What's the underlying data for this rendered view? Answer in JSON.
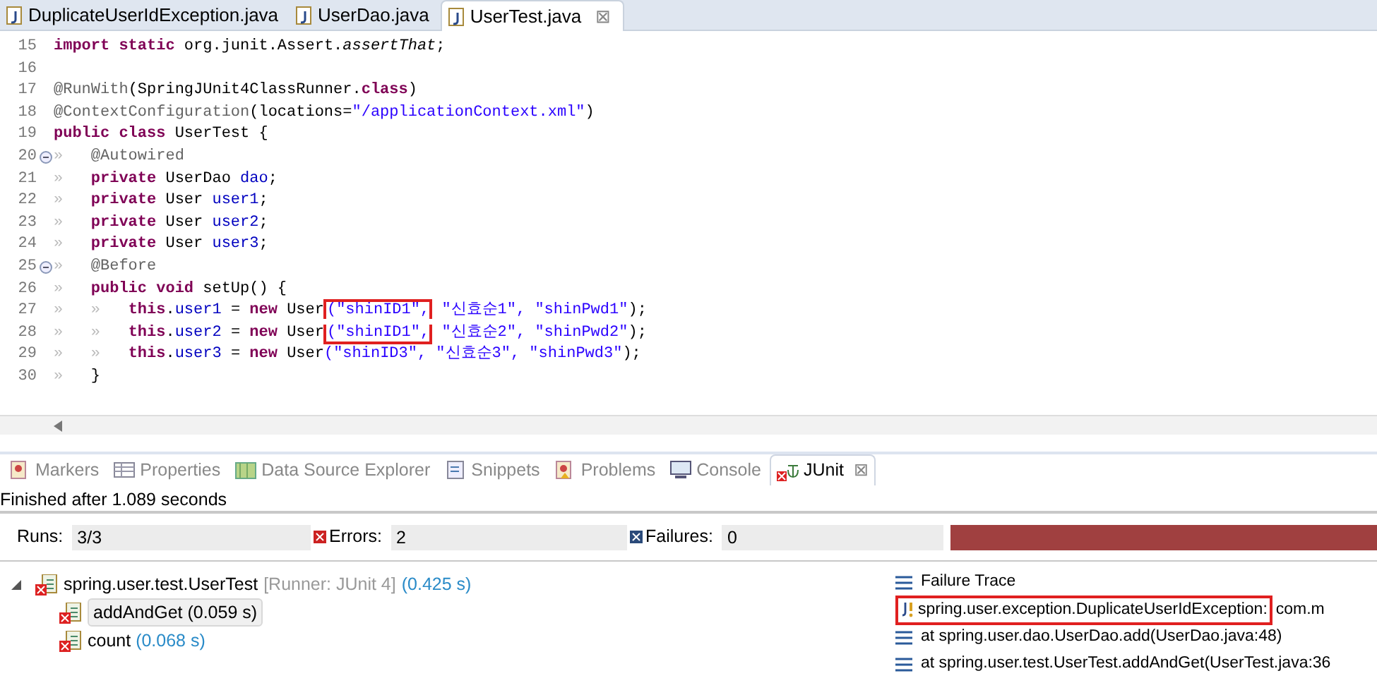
{
  "editor_tabs": [
    {
      "label": "DuplicateUserIdException.java",
      "selected": false
    },
    {
      "label": "UserDao.java",
      "selected": false
    },
    {
      "label": "UserTest.java",
      "selected": true,
      "close": "⊠"
    }
  ],
  "code_lines": [
    {
      "number": "15",
      "segments": [
        {
          "kind": "kw",
          "text": "import static "
        },
        {
          "kind": "plain",
          "text": "org.junit.Assert."
        },
        {
          "kind": "italic",
          "text": "assertThat"
        },
        {
          "kind": "plain",
          "text": ";"
        }
      ]
    },
    {
      "number": "16"
    },
    {
      "number": "17",
      "segments": [
        {
          "kind": "ann",
          "text": "@RunWith"
        },
        {
          "kind": "plain",
          "text": "(SpringJUnit4ClassRunner."
        },
        {
          "kind": "kw",
          "text": "class"
        },
        {
          "kind": "plain",
          "text": ")"
        }
      ]
    },
    {
      "number": "18",
      "segments": [
        {
          "kind": "ann",
          "text": "@ContextConfiguration"
        },
        {
          "kind": "plain",
          "text": "(locations="
        },
        {
          "kind": "str",
          "text": "\"/applicationContext.xml\""
        },
        {
          "kind": "plain",
          "text": ")"
        }
      ]
    },
    {
      "number": "19",
      "segments": [
        {
          "kind": "kw",
          "text": "public class "
        },
        {
          "kind": "plain",
          "text": "UserTest {"
        }
      ]
    },
    {
      "number": "20",
      "fold": true,
      "segments": [
        {
          "kind": "tab",
          "text": "»   "
        },
        {
          "kind": "ann",
          "text": "@Autowired"
        }
      ]
    },
    {
      "number": "21",
      "segments": [
        {
          "kind": "tab",
          "text": "»   "
        },
        {
          "kind": "kw",
          "text": "private "
        },
        {
          "kind": "plain",
          "text": "UserDao "
        },
        {
          "kind": "field",
          "text": "dao"
        },
        {
          "kind": "plain",
          "text": ";"
        }
      ]
    },
    {
      "number": "22",
      "segments": [
        {
          "kind": "tab",
          "text": "»   "
        },
        {
          "kind": "kw",
          "text": "private "
        },
        {
          "kind": "plain",
          "text": "User "
        },
        {
          "kind": "field",
          "text": "user1"
        },
        {
          "kind": "plain",
          "text": ";"
        }
      ]
    },
    {
      "number": "23",
      "segments": [
        {
          "kind": "tab",
          "text": "»   "
        },
        {
          "kind": "kw",
          "text": "private "
        },
        {
          "kind": "plain",
          "text": "User "
        },
        {
          "kind": "field",
          "text": "user2"
        },
        {
          "kind": "plain",
          "text": ";"
        }
      ]
    },
    {
      "number": "24",
      "segments": [
        {
          "kind": "tab",
          "text": "»   "
        },
        {
          "kind": "kw",
          "text": "private "
        },
        {
          "kind": "plain",
          "text": "User "
        },
        {
          "kind": "field",
          "text": "user3"
        },
        {
          "kind": "plain",
          "text": ";"
        }
      ]
    },
    {
      "number": "25",
      "fold": true,
      "segments": [
        {
          "kind": "tab",
          "text": "»   "
        },
        {
          "kind": "ann",
          "text": "@Before"
        }
      ]
    },
    {
      "number": "26",
      "segments": [
        {
          "kind": "tab",
          "text": "»   "
        },
        {
          "kind": "kw",
          "text": "public void "
        },
        {
          "kind": "plain",
          "text": "setUp() {"
        }
      ]
    },
    {
      "number": "27",
      "segments": [
        {
          "kind": "tab",
          "text": "»   »   "
        },
        {
          "kind": "kw",
          "text": "this"
        },
        {
          "kind": "plain",
          "text": "."
        },
        {
          "kind": "field",
          "text": "user1"
        },
        {
          "kind": "plain",
          "text": " = "
        },
        {
          "kind": "kw",
          "text": "new "
        },
        {
          "kind": "plain",
          "text": "User"
        },
        {
          "kind": "str",
          "text": "(\"shinID1\",",
          "boxed": true
        },
        {
          "kind": "str",
          "text": " \"신효순1\", \"shinPwd1\""
        },
        {
          "kind": "plain",
          "text": ");"
        }
      ]
    },
    {
      "number": "28",
      "segments": [
        {
          "kind": "tab",
          "text": "»   »   "
        },
        {
          "kind": "kw",
          "text": "this"
        },
        {
          "kind": "plain",
          "text": "."
        },
        {
          "kind": "field",
          "text": "user2"
        },
        {
          "kind": "plain",
          "text": " = "
        },
        {
          "kind": "kw",
          "text": "new "
        },
        {
          "kind": "plain",
          "text": "User"
        },
        {
          "kind": "str",
          "text": "(\"shinID1\",",
          "boxed": true
        },
        {
          "kind": "str",
          "text": " \"신효순2\", \"shinPwd2\""
        },
        {
          "kind": "plain",
          "text": ");"
        }
      ]
    },
    {
      "number": "29",
      "segments": [
        {
          "kind": "tab",
          "text": "»   »   "
        },
        {
          "kind": "kw",
          "text": "this"
        },
        {
          "kind": "plain",
          "text": "."
        },
        {
          "kind": "field",
          "text": "user3"
        },
        {
          "kind": "plain",
          "text": " = "
        },
        {
          "kind": "kw",
          "text": "new "
        },
        {
          "kind": "plain",
          "text": "User"
        },
        {
          "kind": "str",
          "text": "(\"shinID3\", \"신효순3\", \"shinPwd3\""
        },
        {
          "kind": "plain",
          "text": ");"
        }
      ]
    },
    {
      "number": "30",
      "segments": [
        {
          "kind": "tab",
          "text": "»   "
        },
        {
          "kind": "plain",
          "text": "}"
        }
      ]
    }
  ],
  "view_tabs": [
    {
      "label": "Markers",
      "selected": false
    },
    {
      "label": "Properties",
      "selected": false
    },
    {
      "label": "Data Source Explorer",
      "selected": false
    },
    {
      "label": "Snippets",
      "selected": false
    },
    {
      "label": "Problems",
      "selected": false
    },
    {
      "label": "Console",
      "selected": false
    },
    {
      "label": "JUnit",
      "selected": true,
      "close": "⊠"
    }
  ],
  "status": "Finished after 1.089 seconds",
  "counters": [
    {
      "kind": "runs",
      "label": "Runs:",
      "value": "3/3"
    },
    {
      "kind": "errors",
      "label": "Errors:",
      "value": "2"
    },
    {
      "kind": "failures",
      "label": "Failures:",
      "value": "0"
    }
  ],
  "progress": {
    "level": 1,
    "color": "#a04040"
  },
  "tree": {
    "label": "spring.user.test.UserTest",
    "runner": "[Runner: JUnit 4]",
    "time": "(0.425 s)",
    "expanded": true,
    "children": [
      {
        "label": "addAndGet",
        "time": "(0.059 s)",
        "selected": true
      },
      {
        "label": "count",
        "time": "(0.068 s)",
        "selected": false
      }
    ]
  },
  "trace": {
    "title": "Failure Trace",
    "lines": [
      {
        "kind": "exception",
        "text": "spring.user.exception.DuplicateUserIdException:",
        "rest": "com.m",
        "boxed": true
      },
      {
        "kind": "frame",
        "text": "at spring.user.dao.UserDao.add(UserDao.java:48)"
      },
      {
        "kind": "frame",
        "text": "at spring.user.test.UserTest.addAndGet(UserTest.java:36"
      }
    ]
  }
}
